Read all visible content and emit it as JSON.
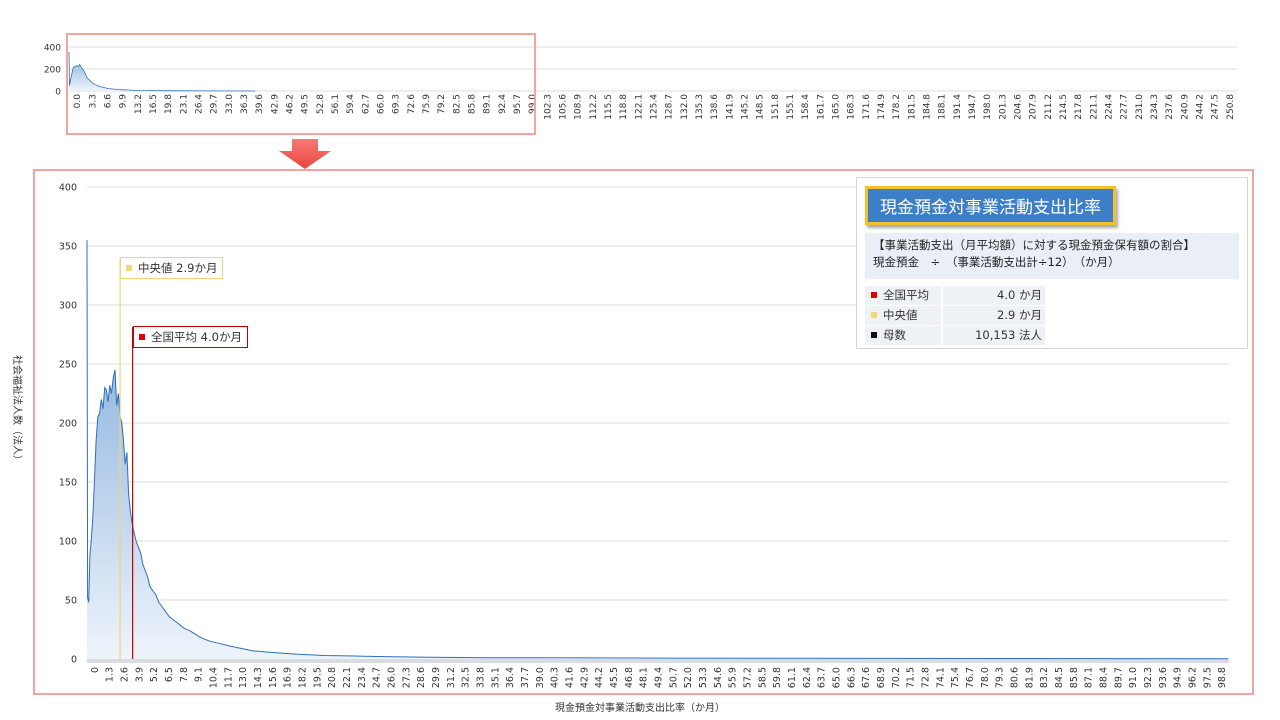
{
  "colors": {
    "mean": "#c00000",
    "median": "#f2d27a",
    "line": "#2e6fb8",
    "fill_top": "#7fa8d8",
    "fill_bottom": "#eef4fb",
    "frame": "#f4a3a3",
    "arrow": "#f0605e"
  },
  "info": {
    "title": "現金預金対事業活動支出比率",
    "desc_line1": "【事業活動支出（月平均額）に対する現金預金保有額の割合】",
    "desc_line2": "現金預金　÷　（事業活動支出計÷12）　（か月）",
    "stats": [
      {
        "label": "全国平均",
        "value": "4.0 か月",
        "marker": "#e00000"
      },
      {
        "label": "中央値",
        "value": "2.9 か月",
        "marker": "#f5d57a"
      },
      {
        "label": "母数",
        "value": "10,153 法人",
        "marker": "#111111"
      }
    ]
  },
  "annotations": {
    "median": "中央値  2.9か月",
    "mean": "全国平均  4.0か月"
  },
  "chart_data": [
    {
      "type": "area",
      "title": "",
      "xlabel": "",
      "ylabel": "",
      "ylim": [
        0,
        400
      ],
      "yticks": [
        0,
        200,
        400
      ],
      "xlim": [
        0,
        250.8
      ],
      "xticks": [
        "0.0",
        "3.3",
        "6.6",
        "9.9",
        "13.2",
        "16.5",
        "19.8",
        "23.1",
        "26.4",
        "29.7",
        "33.0",
        "36.3",
        "39.6",
        "42.9",
        "46.2",
        "49.5",
        "52.8",
        "56.1",
        "59.4",
        "62.7",
        "66.0",
        "69.3",
        "72.6",
        "75.9",
        "79.2",
        "82.5",
        "85.8",
        "89.1",
        "92.4",
        "95.7",
        "99.0",
        "102.3",
        "105.6",
        "108.9",
        "112.2",
        "115.5",
        "118.8",
        "122.1",
        "125.4",
        "128.7",
        "132.0",
        "135.3",
        "138.6",
        "141.9",
        "145.2",
        "148.5",
        "151.8",
        "155.1",
        "158.4",
        "161.7",
        "165.0",
        "168.3",
        "171.6",
        "174.9",
        "178.2",
        "181.5",
        "184.8",
        "188.1",
        "191.4",
        "194.7",
        "198.0",
        "201.3",
        "204.6",
        "207.9",
        "211.2",
        "214.5",
        "217.8",
        "221.1",
        "224.4",
        "227.7",
        "231.0",
        "234.3",
        "237.6",
        "240.9",
        "244.2",
        "247.5",
        "250.8"
      ],
      "x": [
        0,
        0.1,
        0.3,
        0.5,
        0.8,
        1.0,
        1.3,
        1.6,
        2.0,
        2.3,
        2.6,
        3.0,
        3.3,
        3.6,
        3.9,
        4.3,
        4.6,
        5.0,
        5.5,
        6.0,
        6.5,
        7.0,
        7.8,
        8.5,
        9.5,
        10.5,
        11.5,
        13,
        15,
        17,
        20,
        25,
        30,
        40
      ],
      "values": [
        355,
        50,
        95,
        130,
        195,
        215,
        225,
        228,
        225,
        240,
        220,
        195,
        175,
        150,
        115,
        105,
        90,
        75,
        62,
        52,
        42,
        36,
        28,
        22,
        18,
        14,
        11,
        8,
        5,
        4,
        3,
        2,
        1,
        0
      ]
    },
    {
      "type": "area",
      "title": "",
      "xlabel": "現金預金対事業活動支出比率（か月）",
      "ylabel": "社会福祉法人数（法人）",
      "ylim": [
        0,
        400
      ],
      "yticks": [
        0,
        50,
        100,
        150,
        200,
        250,
        300,
        350,
        400
      ],
      "xlim": [
        0,
        100.1
      ],
      "xticks": [
        "0",
        "1.3",
        "2.6",
        "3.9",
        "5.2",
        "6.5",
        "7.8",
        "9.1",
        "10.4",
        "11.7",
        "13.0",
        "14.3",
        "15.6",
        "16.9",
        "18.2",
        "19.5",
        "20.8",
        "22.1",
        "23.4",
        "24.7",
        "26.0",
        "27.3",
        "28.6",
        "29.9",
        "31.2",
        "32.5",
        "33.8",
        "35.1",
        "36.4",
        "37.7",
        "39.0",
        "40.3",
        "41.6",
        "42.9",
        "44.2",
        "45.5",
        "46.8",
        "48.1",
        "49.4",
        "50.7",
        "52.0",
        "53.3",
        "54.6",
        "55.9",
        "57.2",
        "58.5",
        "59.8",
        "61.1",
        "62.4",
        "63.7",
        "65.0",
        "66.3",
        "67.6",
        "68.9",
        "70.2",
        "71.5",
        "72.8",
        "74.1",
        "75.4",
        "76.7",
        "78.0",
        "79.3",
        "80.6",
        "81.9",
        "83.2",
        "84.5",
        "85.8",
        "87.1",
        "88.4",
        "89.7",
        "91.0",
        "92.3",
        "93.6",
        "94.9",
        "96.2",
        "97.5",
        "98.8"
      ],
      "x": [
        0,
        0.05,
        0.15,
        0.25,
        0.35,
        0.5,
        0.65,
        0.8,
        0.95,
        1.1,
        1.25,
        1.4,
        1.55,
        1.7,
        1.85,
        2.0,
        2.15,
        2.3,
        2.45,
        2.6,
        2.75,
        2.9,
        3.05,
        3.2,
        3.35,
        3.5,
        3.65,
        3.8,
        3.95,
        4.1,
        4.3,
        4.5,
        4.7,
        4.9,
        5.1,
        5.3,
        5.5,
        5.75,
        6.0,
        6.3,
        6.6,
        6.9,
        7.2,
        7.6,
        8.0,
        8.5,
        9.0,
        9.5,
        10.0,
        10.8,
        11.7,
        12.5,
        13.5,
        14.5,
        15.6,
        17,
        18.5,
        20.8,
        23.4,
        26,
        30,
        35,
        40,
        50,
        60,
        70,
        80,
        90,
        100
      ],
      "values": [
        355,
        52,
        48,
        88,
        98,
        118,
        150,
        185,
        205,
        208,
        220,
        212,
        230,
        228,
        218,
        232,
        225,
        238,
        245,
        215,
        225,
        205,
        200,
        185,
        165,
        175,
        140,
        125,
        115,
        108,
        100,
        95,
        90,
        80,
        75,
        70,
        62,
        58,
        55,
        48,
        44,
        40,
        36,
        33,
        30,
        26,
        24,
        21,
        18,
        15,
        13,
        11,
        9,
        7,
        6,
        5,
        4,
        3,
        2.5,
        2,
        1.5,
        1,
        1,
        0.8,
        0.6,
        0.5,
        0.4,
        0.3,
        0.2
      ],
      "median": 2.9,
      "mean": 4.0
    }
  ]
}
